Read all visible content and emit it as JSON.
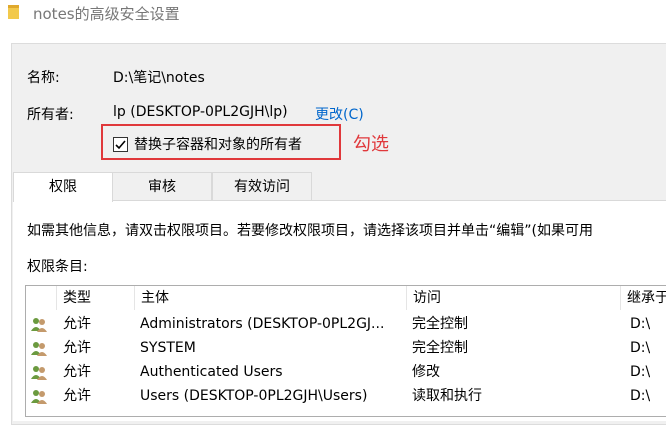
{
  "window": {
    "title": "notes的高级安全设置"
  },
  "header": {
    "name_label": "名称:",
    "name_value": "D:\\笔记\\notes",
    "owner_label": "所有者:",
    "owner_value": "lp (DESKTOP-0PL2GJH\\lp)",
    "change_link": "更改(C)",
    "replace_owner_label": "替换子容器和对象的所有者",
    "replace_owner_checked": true
  },
  "annotation": {
    "text": "勾选",
    "color": "#e0383b"
  },
  "tabs": [
    {
      "label": "权限",
      "active": true
    },
    {
      "label": "审核",
      "active": false
    },
    {
      "label": "有效访问",
      "active": false
    }
  ],
  "permissions": {
    "info_text": "如需其他信息，请双击权限项目。若要修改权限项目，请选择该项目并单击“编辑”(如果可用",
    "entries_label": "权限条目:",
    "columns": [
      "类型",
      "主体",
      "访问",
      "继承于"
    ],
    "rows": [
      {
        "type": "允许",
        "principal": "Administrators (DESKTOP-0PL2GJ...",
        "access": "完全控制",
        "inherited": "D:\\"
      },
      {
        "type": "允许",
        "principal": "SYSTEM",
        "access": "完全控制",
        "inherited": "D:\\"
      },
      {
        "type": "允许",
        "principal": "Authenticated Users",
        "access": "修改",
        "inherited": "D:\\"
      },
      {
        "type": "允许",
        "principal": "Users (DESKTOP-0PL2GJH\\Users)",
        "access": "读取和执行",
        "inherited": "D:\\"
      }
    ]
  }
}
